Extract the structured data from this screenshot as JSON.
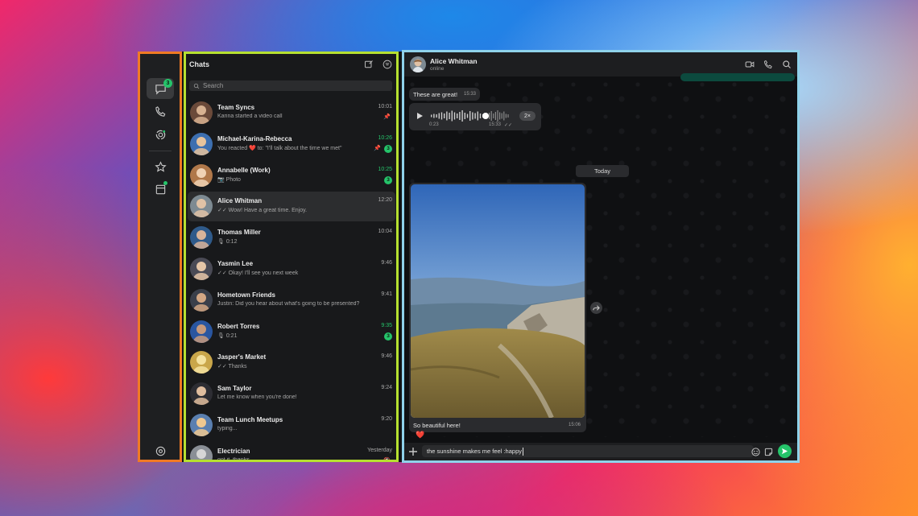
{
  "colors": {
    "accent_green": "#25c46a",
    "read_tick": "#53a8f0",
    "rail_outline": "#f07a24",
    "list_outline": "#b6e030",
    "convo_outline": "#8fd2ea"
  },
  "rail": {
    "items": [
      {
        "icon": "chat-bubble-icon",
        "badge": "3",
        "active": true
      },
      {
        "icon": "phone-icon"
      },
      {
        "icon": "status-ring-icon"
      },
      {
        "icon": "star-icon"
      },
      {
        "icon": "archive-icon",
        "dot": true
      },
      {
        "icon": "settings-icon"
      }
    ]
  },
  "chatlist": {
    "title": "Chats",
    "search_placeholder": "Search",
    "chats": [
      {
        "name": "Team Syncs",
        "time": "10:01",
        "preview": "Karina started a video call",
        "pinned": true
      },
      {
        "name": "Michael-Karina-Rebecca",
        "time": "10:26",
        "preview": "You reacted ❤️ to: \"I'll talk about the time we met\"",
        "badge": "3",
        "pinned": true,
        "time_green": true
      },
      {
        "name": "Annabelle (Work)",
        "time": "10:25",
        "preview": "📷 Photo",
        "badge": "3",
        "time_green": true
      },
      {
        "name": "Alice Whitman",
        "time": "12:20",
        "preview": "✓✓ Wow! Have a great time. Enjoy.",
        "selected": true
      },
      {
        "name": "Thomas Miller",
        "time": "10:04",
        "preview": "🎙 0:12"
      },
      {
        "name": "Yasmin Lee",
        "time": "9:46",
        "preview": "✓✓ Okay! I'll see you next week"
      },
      {
        "name": "Hometown Friends",
        "time": "9:41",
        "preview": "Justin: Did you hear about what's going to be presented?"
      },
      {
        "name": "Robert Torres",
        "time": "9:35",
        "preview": "🎙 0:21",
        "badge": "3",
        "time_green": true
      },
      {
        "name": "Jasper's Market",
        "time": "9:46",
        "preview": "✓✓ Thanks"
      },
      {
        "name": "Sam Taylor",
        "time": "9:24",
        "preview": "Let me know when you're done!"
      },
      {
        "name": "Team Lunch Meetups",
        "time": "9:20",
        "preview": "typing..."
      },
      {
        "name": "Electrician",
        "time": "Yesterday",
        "preview": "got it, thanks",
        "muted": true
      }
    ]
  },
  "conversation": {
    "contact_name": "Alice Whitman",
    "status": "online",
    "messages": {
      "text1": "These are great!",
      "text1_time": "15:33",
      "voice_duration": "0:23",
      "voice_time": "15:33",
      "voice_speed": "2×",
      "day": "Today",
      "photo_caption": "So beautiful here!",
      "photo_time": "15:06",
      "reaction": "❤️"
    },
    "emoji_suggestions": [
      "😄",
      "😂",
      "🤣",
      "😁",
      "🙏",
      "😆",
      "😊",
      "🥲",
      "☺️",
      "🎂",
      "👍",
      "👏",
      "😀",
      "😇",
      "🤗",
      "😃"
    ],
    "composer_text": "the sunshine makes me feel :happy"
  }
}
